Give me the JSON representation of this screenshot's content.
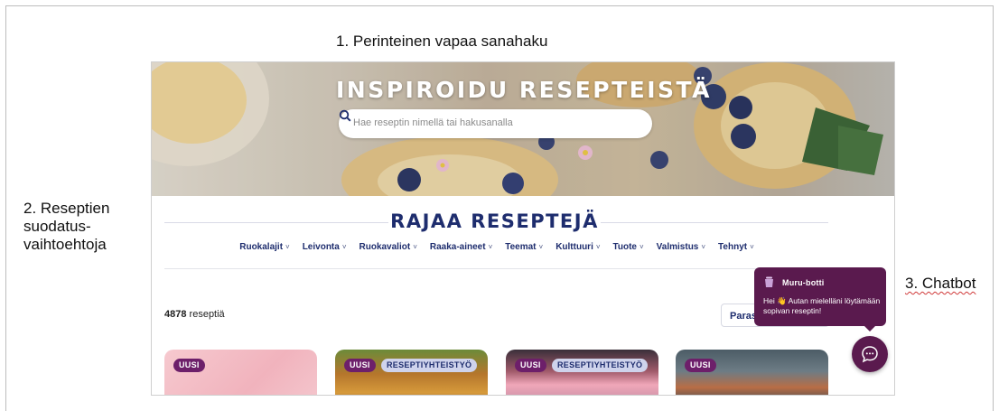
{
  "annotations": {
    "label_1": "1. Perinteinen vapaa sanahaku",
    "label_2": "2. Reseptien suodatus-vaihtoehtoja",
    "label_3": "3. Chatbot"
  },
  "hero": {
    "title": "INSPIROIDU RESEPTEISTÄ",
    "search_placeholder": "Hae reseptin nimellä tai hakusanalla",
    "search_icon": "search-icon"
  },
  "filter": {
    "title": "RAJAA RESEPTEJÄ",
    "categories": [
      {
        "label": "Ruokalajit"
      },
      {
        "label": "Leivonta"
      },
      {
        "label": "Ruokavaliot"
      },
      {
        "label": "Raaka-aineet"
      },
      {
        "label": "Teemat"
      },
      {
        "label": "Kulttuuri"
      },
      {
        "label": "Tuote"
      },
      {
        "label": "Valmistus"
      },
      {
        "label": "Tehnyt"
      }
    ],
    "chevron": "˅",
    "result_count": "4878",
    "result_suffix": " reseptiä",
    "sort_label": "Paras"
  },
  "cards": [
    {
      "badges": [
        "UUSI"
      ]
    },
    {
      "badges": [
        "UUSI",
        "RESEPTIYHTEISTYÖ"
      ]
    },
    {
      "badges": [
        "UUSI",
        "RESEPTIYHTEISTYÖ"
      ]
    },
    {
      "badges": [
        "UUSI"
      ]
    }
  ],
  "chatbot": {
    "name": "Muru-botti",
    "message": "Hei 👋 Autan mielelläni löytämään sopivan reseptin!",
    "icon": "chat-bubble-icon",
    "colors": {
      "primary": "#5a1a4e"
    }
  },
  "colors": {
    "brand_navy": "#1e2d6e",
    "badge_purple": "#6d1f6a",
    "badge_light": "#cfd3ec"
  }
}
